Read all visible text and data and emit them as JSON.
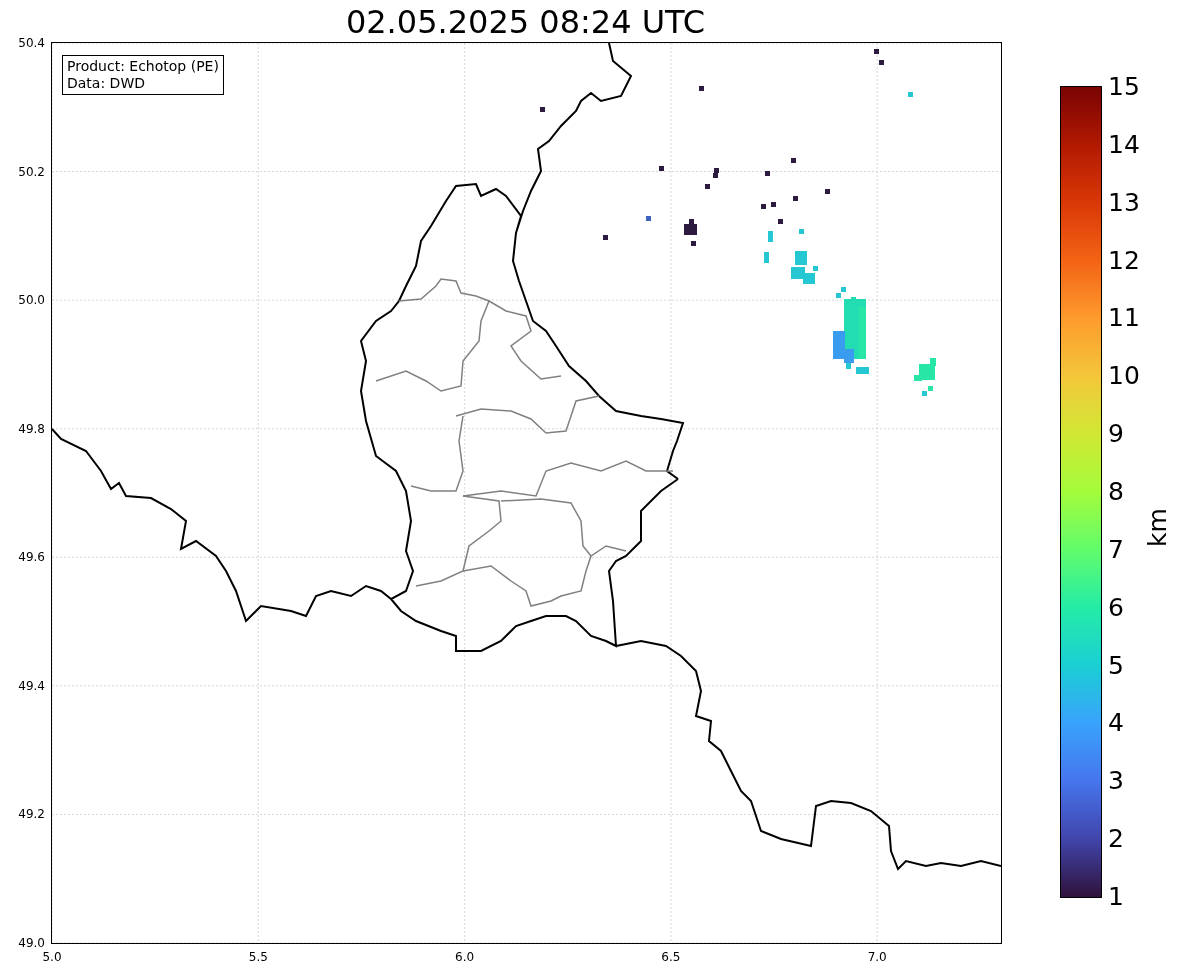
{
  "title": "02.05.2025 08:24 UTC",
  "info_box": {
    "lines": [
      "Product: Echotop (PE)",
      "Data: DWD"
    ]
  },
  "map": {
    "x_tick_labels": [
      "5.0",
      "5.5",
      "6.0",
      "6.5",
      "7.0"
    ],
    "y_tick_labels": [
      "50.4",
      "50.2",
      "50.0",
      "49.8",
      "49.6",
      "49.4",
      "49.2",
      "49.0"
    ]
  },
  "colorbar": {
    "label": "km",
    "tick_labels": [
      "15",
      "14",
      "13",
      "12",
      "11",
      "10",
      "9",
      "8",
      "7",
      "6",
      "5",
      "4",
      "3",
      "2",
      "1"
    ]
  }
}
